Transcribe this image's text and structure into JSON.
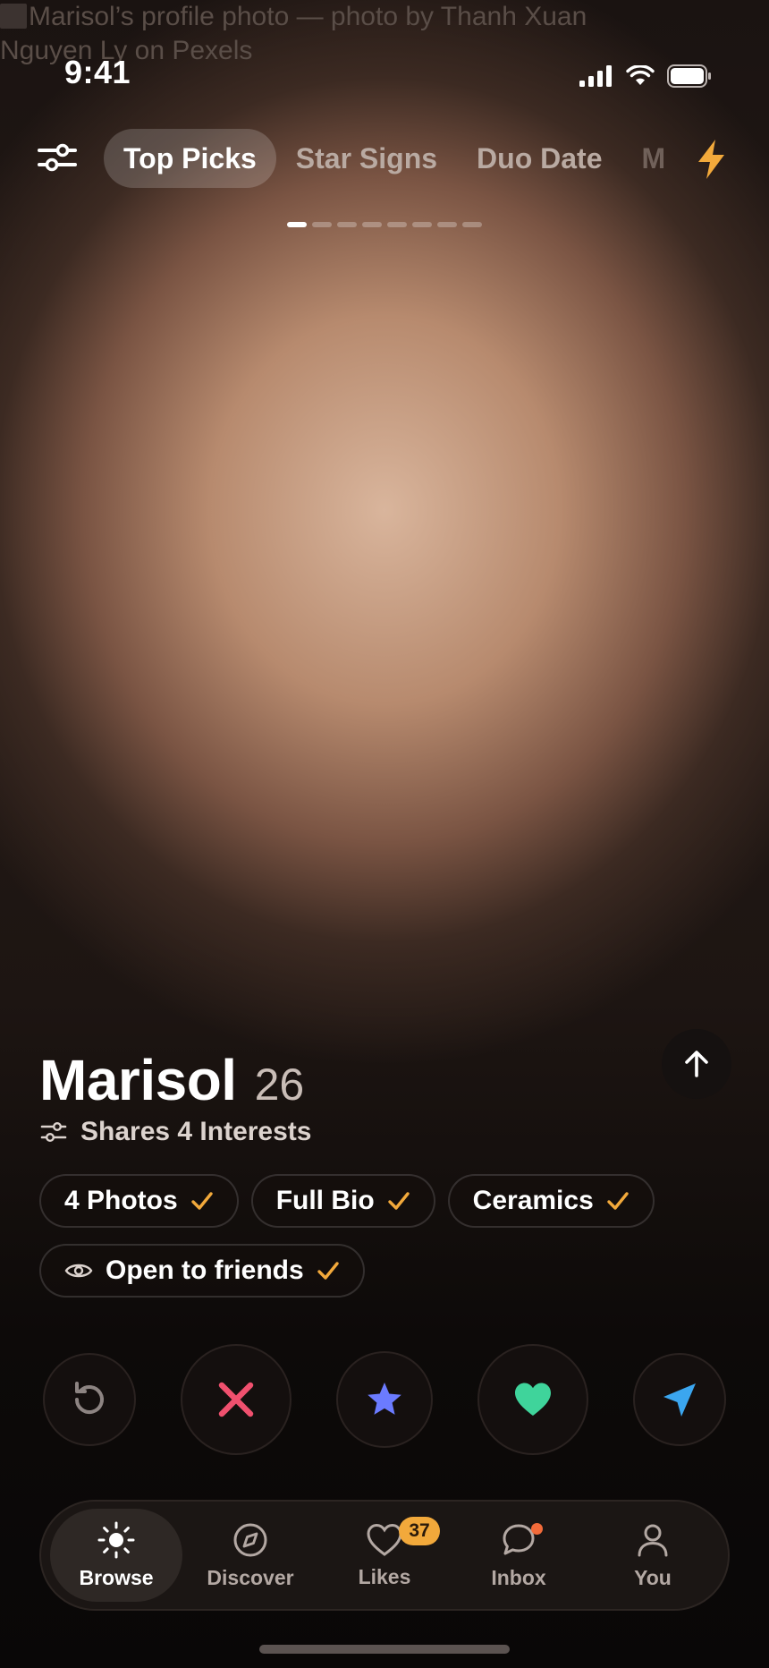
{
  "photo": {
    "alt_text": "Marisol’s profile photo — photo by Thanh Xuan Nguyen Ly on Pexels"
  },
  "status_bar": {
    "time": "9:41"
  },
  "top_tabs": {
    "tabs": [
      "Top Picks",
      "Star Signs",
      "Duo Date",
      "M"
    ],
    "active_index": 0
  },
  "photo_pager": {
    "count": 8,
    "current": 1
  },
  "profile": {
    "name": "Marisol",
    "age": "26",
    "shared_interests": "Shares 4 Interests",
    "chips": [
      {
        "label": "4 Photos",
        "verified": true
      },
      {
        "label": "Full Bio",
        "verified": true
      },
      {
        "label": "Ceramics",
        "verified": true
      },
      {
        "label": "Open to friends",
        "verified": true,
        "icon": "eye-icon"
      }
    ]
  },
  "actions": [
    "rewind-icon",
    "close-icon",
    "star-icon",
    "heart-icon",
    "send-icon"
  ],
  "nav": {
    "items": [
      {
        "label": "Browse",
        "icon": "sun-icon",
        "active": true
      },
      {
        "label": "Discover",
        "icon": "compass-icon"
      },
      {
        "label": "Likes",
        "icon": "heart-outline-icon",
        "badge": "37"
      },
      {
        "label": "Inbox",
        "icon": "chat-icon",
        "dot": true
      },
      {
        "label": "You",
        "icon": "person-icon"
      }
    ]
  },
  "colors": {
    "accent": "#f2a93b",
    "pass": "#f0506e",
    "super_like": "#6b7bff",
    "like": "#3fd49b",
    "send": "#3ba6ef",
    "notification_dot": "#f26b3a"
  }
}
